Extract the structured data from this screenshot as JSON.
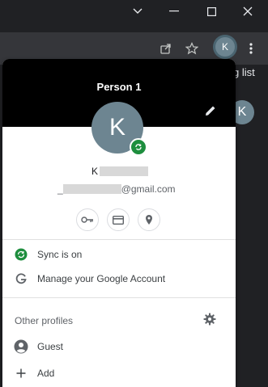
{
  "window": {
    "minimize_glyph": "—",
    "maximize_glyph": "☐",
    "close_glyph": "✕",
    "chevron_glyph": "∨"
  },
  "toolbar": {
    "avatar_initial": "K",
    "menu_glyph": "⋮"
  },
  "background": {
    "reading_list_text": "g list",
    "avatar_initial": "K"
  },
  "profile_menu": {
    "header_title": "Person 1",
    "avatar_initial": "K",
    "account_name_visible": "K",
    "account_email_visible": "@gmail.com",
    "email_prefix_visible": "_",
    "quick_actions": [
      "passwords",
      "payment-methods",
      "addresses"
    ],
    "sync_label": "Sync is on",
    "manage_account_label": "Manage your Google Account",
    "other_profiles_title": "Other profiles",
    "profiles": [
      {
        "label": "Guest"
      },
      {
        "label": "Add"
      }
    ],
    "colors": {
      "header_bg": "#000000",
      "avatar_bg": "#6d8591",
      "sync_green": "#1e8e3e"
    }
  }
}
